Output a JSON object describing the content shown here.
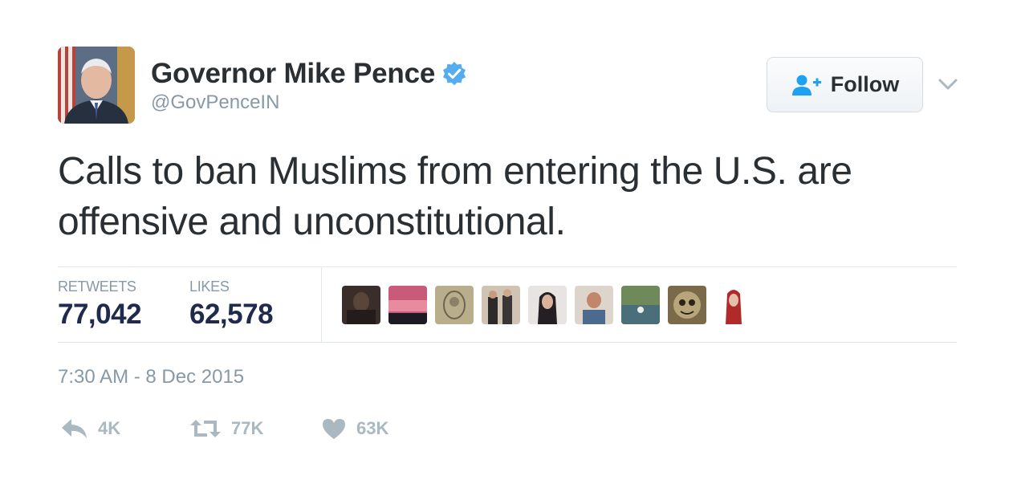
{
  "user": {
    "display_name": "Governor Mike Pence",
    "handle": "@GovPenceIN",
    "verified": true
  },
  "follow_button": {
    "label": "Follow",
    "icon": "follow-user-plus-icon"
  },
  "tweet": {
    "text": "Calls to ban Muslims from entering the U.S. are offensive and unconstitutional.",
    "timestamp": "7:30 AM - 8 Dec 2015"
  },
  "stats": {
    "retweets_label": "RETWEETS",
    "retweets_value": "77,042",
    "likes_label": "LIKES",
    "likes_value": "62,578"
  },
  "actions": {
    "reply_count": "4K",
    "retweet_count": "77K",
    "like_count": "63K"
  },
  "colors": {
    "text": "#292f33",
    "muted": "#8899a6",
    "stat_value": "#1f2a4d",
    "action": "#aab8c2",
    "verified": "#55acee",
    "follow_icon": "#1da1f2"
  }
}
